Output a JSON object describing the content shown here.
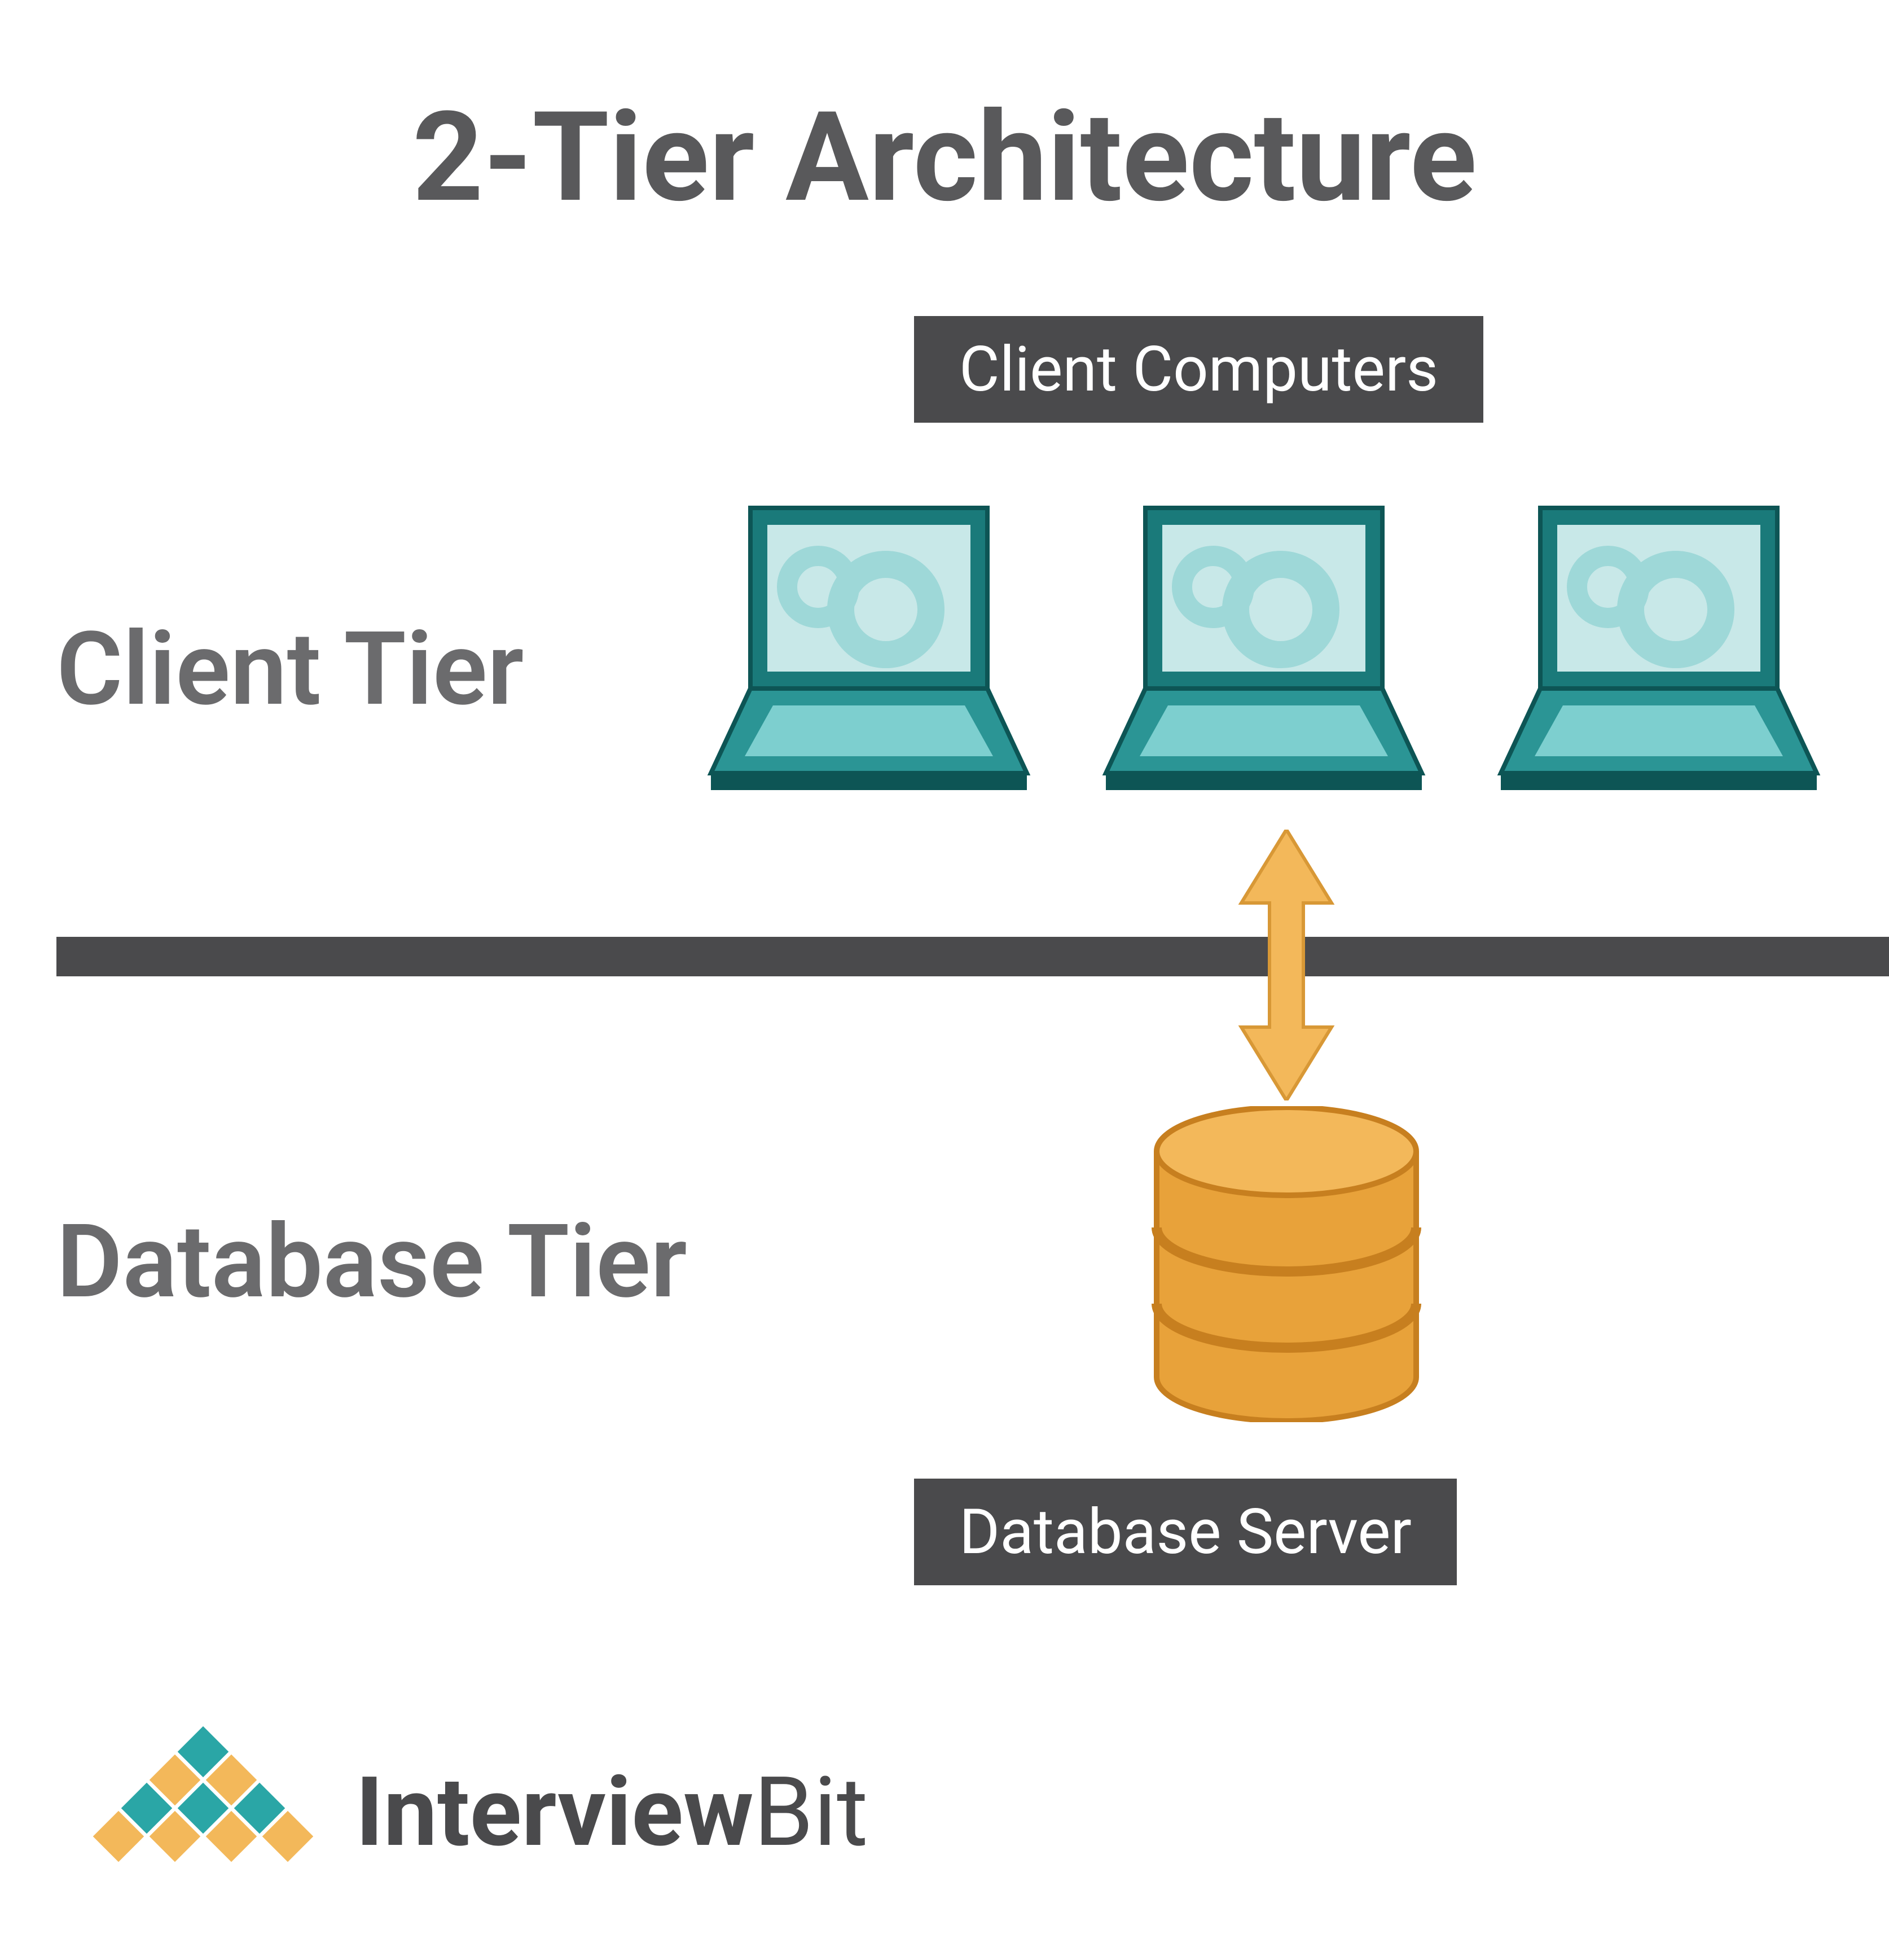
{
  "title": "2-Tier Architecture",
  "badges": {
    "top": "Client Computers",
    "bottom": "Database Server"
  },
  "tiers": {
    "client": "Client Tier",
    "database": "Database Tier"
  },
  "logo": {
    "bold": "Interview",
    "light": "Bit"
  },
  "colors": {
    "text_gray": "#59595b",
    "badge_bg": "#4a4a4c",
    "teal_dark": "#1a7a7a",
    "teal_light": "#7dcfcf",
    "teal_screen": "#c8e8e8",
    "orange": "#e8a23a",
    "orange_dark": "#c77f1f"
  },
  "icons": {
    "laptop": "laptop-icon",
    "database": "database-cylinder-icon",
    "arrow": "bidirectional-arrow-icon",
    "logo_mark": "diamond-pyramid-icon"
  }
}
